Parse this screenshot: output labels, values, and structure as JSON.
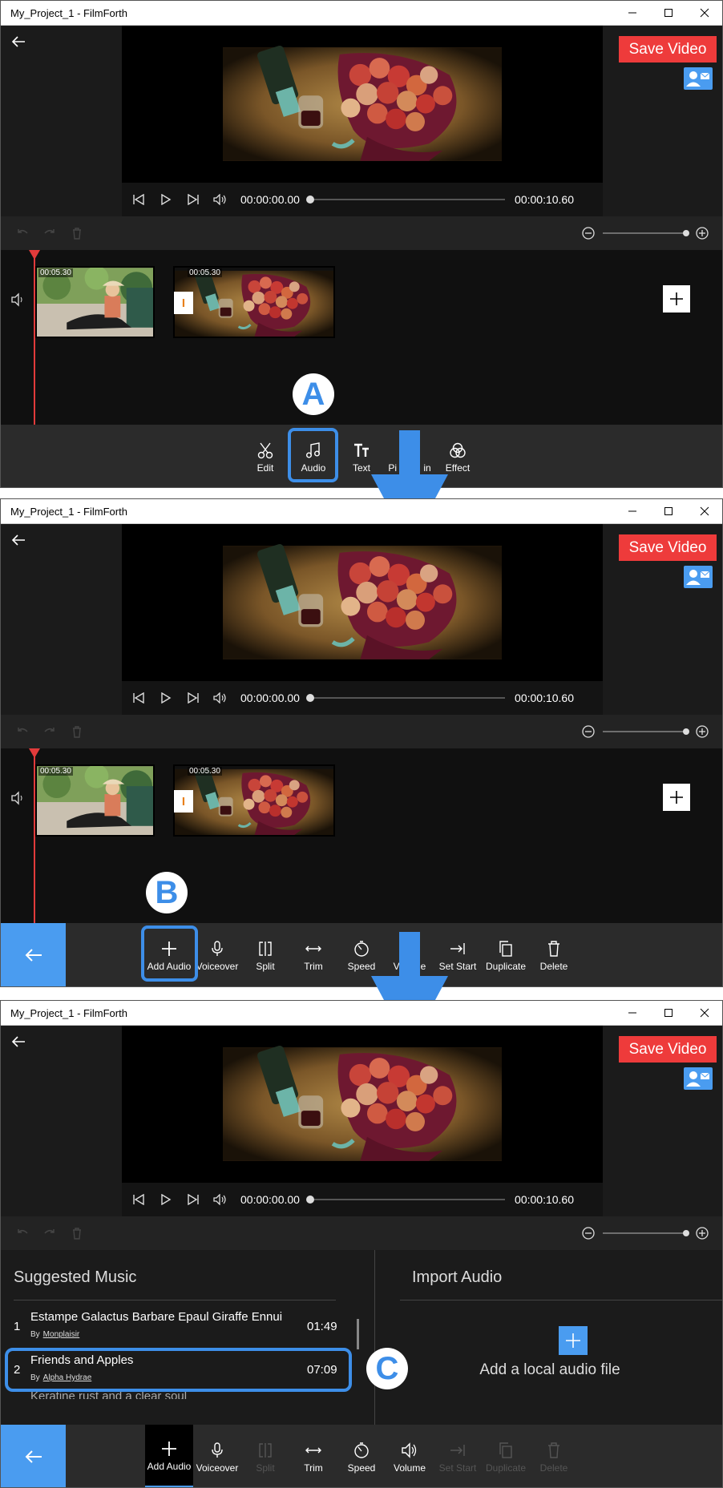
{
  "app": {
    "window_title": "My_Project_1 - FilmForth",
    "save_label": "Save Video",
    "time_start": "00:00:00.00",
    "time_end": "00:00:10.60",
    "clip_durations": [
      "00:05.30",
      "00:05.30"
    ],
    "transition_label": "I"
  },
  "main_tools": [
    {
      "label": "Edit",
      "icon": "scissors-icon"
    },
    {
      "label": "Audio",
      "icon": "music-note-icon"
    },
    {
      "label": "Text",
      "icon": "text-icon"
    },
    {
      "label": "Picture in Picture",
      "visible": "Pi          in",
      "icon": "pip-icon"
    },
    {
      "label": "Effect",
      "icon": "effect-icon"
    }
  ],
  "audio_tools": [
    {
      "label": "Add Audio",
      "icon": "plus-icon"
    },
    {
      "label": "Voiceover",
      "icon": "microphone-icon"
    },
    {
      "label": "Split",
      "icon": "split-icon"
    },
    {
      "label": "Trim",
      "icon": "trim-icon"
    },
    {
      "label": "Speed",
      "icon": "speed-icon"
    },
    {
      "label": "Volume",
      "icon": "volume-icon"
    },
    {
      "label": "Set Start",
      "icon": "set-start-icon"
    },
    {
      "label": "Duplicate",
      "icon": "duplicate-icon"
    },
    {
      "label": "Delete",
      "icon": "trash-icon"
    }
  ],
  "panel2_partial": {
    "volume": "V",
    "volume_tail": "e"
  },
  "music": {
    "suggested_title": "Suggested Music",
    "import_title": "Import Audio",
    "add_local": "Add a local audio file",
    "by_label": "By",
    "tracks": [
      {
        "num": "1",
        "name": "Estampe Galactus Barbare Epaul Giraffe Ennui",
        "artist": "Monplaisir",
        "duration": "01:49"
      },
      {
        "num": "2",
        "name": "Friends and Apples",
        "artist": "Alpha Hydrae",
        "duration": "07:09"
      },
      {
        "num": "",
        "name": "Keratine rust and a clear soul",
        "artist": "",
        "duration": ""
      }
    ]
  },
  "badges": {
    "a": "A",
    "b": "B",
    "c": "C"
  },
  "colors": {
    "accent": "#4a9cf0",
    "save": "#ee3b3b",
    "highlight": "#3d8ee8",
    "ruler": "#e23b3b"
  }
}
